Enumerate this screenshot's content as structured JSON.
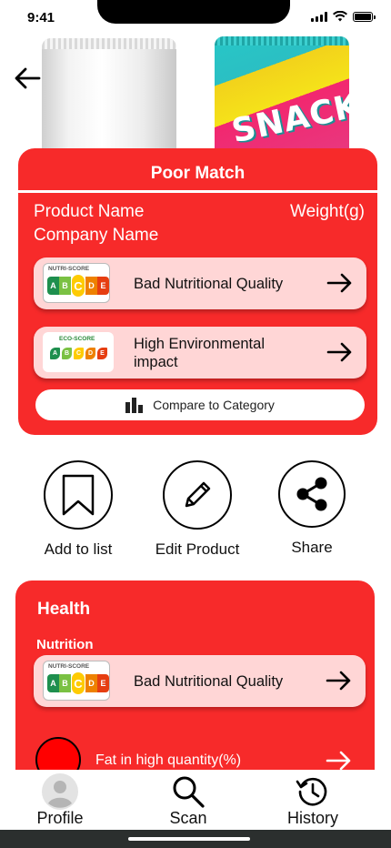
{
  "status_bar": {
    "time": "9:41"
  },
  "product_images": {
    "snack_pack_text": "SNACK"
  },
  "match_card": {
    "title": "Poor Match",
    "product_name": "Product Name",
    "company_name": "Company Name",
    "weight": "Weight(g)",
    "nutri_score": {
      "logo_label": "NUTRI-SCORE",
      "grades": [
        "A",
        "B",
        "C",
        "D",
        "E"
      ],
      "selected": "C",
      "label": "Bad Nutritional Quality"
    },
    "eco_score": {
      "logo_label": "ECO-SCORE",
      "grades": [
        "A",
        "B",
        "C",
        "D",
        "E"
      ],
      "label_line1": "High Environmental",
      "label_line2": "impact"
    },
    "compare_label": "Compare to Category"
  },
  "actions": [
    {
      "label": "Add to list",
      "icon": "bookmark-icon"
    },
    {
      "label": "Edit Product",
      "icon": "pencil-icon"
    },
    {
      "label": "Share",
      "icon": "share-icon"
    }
  ],
  "health_card": {
    "title": "Health",
    "section_label": "Nutrition",
    "nutri_score": {
      "logo_label": "NUTRI-SCORE",
      "grades": [
        "A",
        "B",
        "C",
        "D",
        "E"
      ],
      "selected": "C",
      "label": "Bad Nutritional Quality"
    },
    "fat_label": "Fat in high quantity(%)"
  },
  "bottom_nav": [
    {
      "label": "Profile",
      "icon": "profile-icon"
    },
    {
      "label": "Scan",
      "icon": "search-icon"
    },
    {
      "label": "History",
      "icon": "history-icon"
    }
  ],
  "colors": {
    "accent_red": "#f72a2a",
    "pill_bg": "#ffd6d6",
    "nutri_a": "#1e8f4e",
    "nutri_b": "#7ac143",
    "nutri_c": "#fecb02",
    "nutri_d": "#ee8100",
    "nutri_e": "#e63e11"
  }
}
